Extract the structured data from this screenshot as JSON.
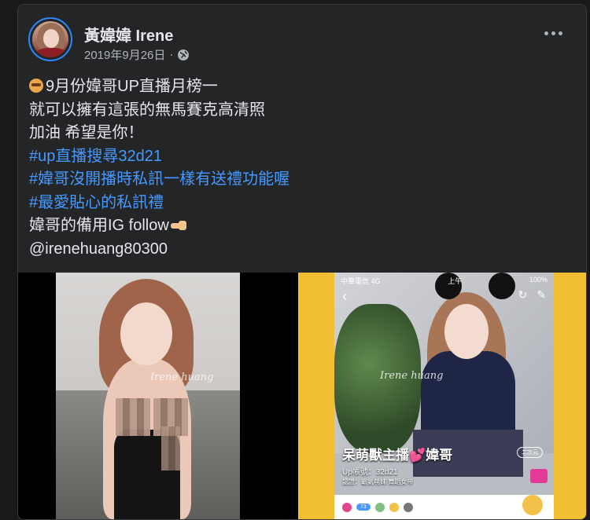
{
  "post": {
    "author": "黃媁媁 Irene",
    "date": "2019年9月26日",
    "separator": "·",
    "privacy_icon": "globe-icon",
    "more_icon": "more-dots-icon",
    "lines": [
      {
        "text": "9月份媁哥UP直播月榜一",
        "type": "text"
      },
      {
        "text": "就可以擁有這張的無馬賽克高清照",
        "type": "text"
      },
      {
        "text": "加油 希望是你！",
        "type": "text"
      },
      {
        "text": "#up直播搜尋32d21",
        "type": "hashtag"
      },
      {
        "text": "#媁哥沒開播時私訊一樣有送禮功能喔",
        "type": "hashtag"
      },
      {
        "text": "#最愛貼心的私訊禮",
        "type": "hashtag"
      },
      {
        "text": "媁哥的備用IG follow",
        "type": "text"
      },
      {
        "text": "@irenehuang80300",
        "type": "text"
      }
    ]
  },
  "photos": {
    "left_watermark": "Irene huang",
    "right_watermark": "Irene huang",
    "app": {
      "status_left": "中華電信 4G",
      "status_center": "上午",
      "status_right": "100%",
      "back_icon": "back-arrow-icon",
      "refresh_icon": "refresh-icon",
      "edit_icon": "edit-icon",
      "host_name": "呆萌獸主播💕媁哥",
      "host_badge": "二次元",
      "up_id": "Up帳號：32d21",
      "tags": "認證：霸氣萌妹 舞蹈女帝",
      "level_pill": "73"
    }
  },
  "colors": {
    "background": "#18191a",
    "card": "#242526",
    "text": "#e4e6eb",
    "secondary": "#b0b3b8",
    "link": "#4599ff",
    "right_bg": "#f0bf33"
  }
}
